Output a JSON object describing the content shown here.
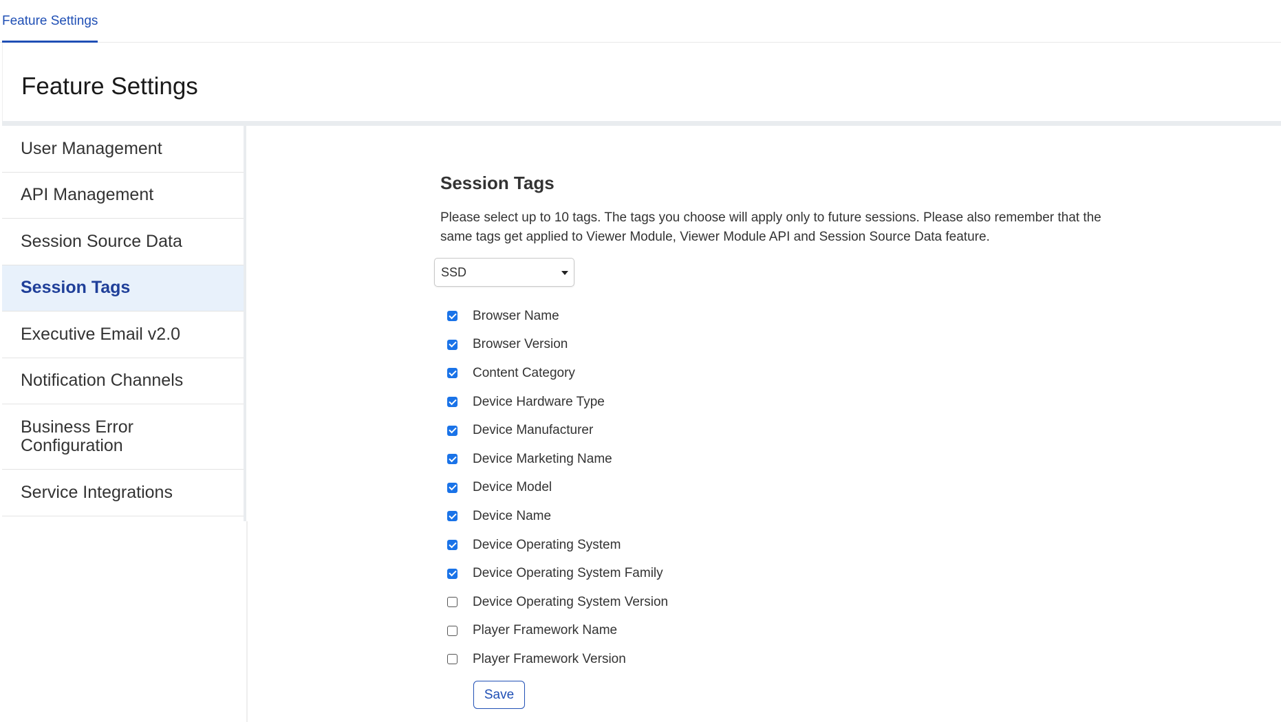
{
  "top_tabs": [
    {
      "label": "Feature Settings",
      "active": true
    }
  ],
  "page": {
    "title": "Feature Settings"
  },
  "sidebar": {
    "items": [
      {
        "label": "User Management",
        "active": false
      },
      {
        "label": "API Management",
        "active": false
      },
      {
        "label": "Session Source Data",
        "active": false
      },
      {
        "label": "Session Tags",
        "active": true
      },
      {
        "label": "Executive Email v2.0",
        "active": false
      },
      {
        "label": "Notification Channels",
        "active": false
      },
      {
        "label": "Business Error Configuration",
        "active": false
      },
      {
        "label": "Service Integrations",
        "active": false
      }
    ]
  },
  "main": {
    "section_title": "Session Tags",
    "description": "Please select up to 10 tags. The tags you choose will apply only to future sessions. Please also remember that the same tags get applied to Viewer Module, Viewer Module API and Session Source Data feature.",
    "select": {
      "value": "SSD"
    },
    "tags": [
      {
        "label": "Browser Name",
        "checked": true
      },
      {
        "label": "Browser Version",
        "checked": true
      },
      {
        "label": "Content Category",
        "checked": true
      },
      {
        "label": "Device Hardware Type",
        "checked": true
      },
      {
        "label": "Device Manufacturer",
        "checked": true
      },
      {
        "label": "Device Marketing Name",
        "checked": true
      },
      {
        "label": "Device Model",
        "checked": true
      },
      {
        "label": "Device Name",
        "checked": true
      },
      {
        "label": "Device Operating System",
        "checked": true
      },
      {
        "label": "Device Operating System Family",
        "checked": true
      },
      {
        "label": "Device Operating System Version",
        "checked": false
      },
      {
        "label": "Player Framework Name",
        "checked": false
      },
      {
        "label": "Player Framework Version",
        "checked": false
      }
    ],
    "save_label": "Save"
  },
  "colors": {
    "accent": "#1f4fb5",
    "checkbox_checked": "#1a73e8",
    "active_item_bg": "#e8f1fb"
  }
}
